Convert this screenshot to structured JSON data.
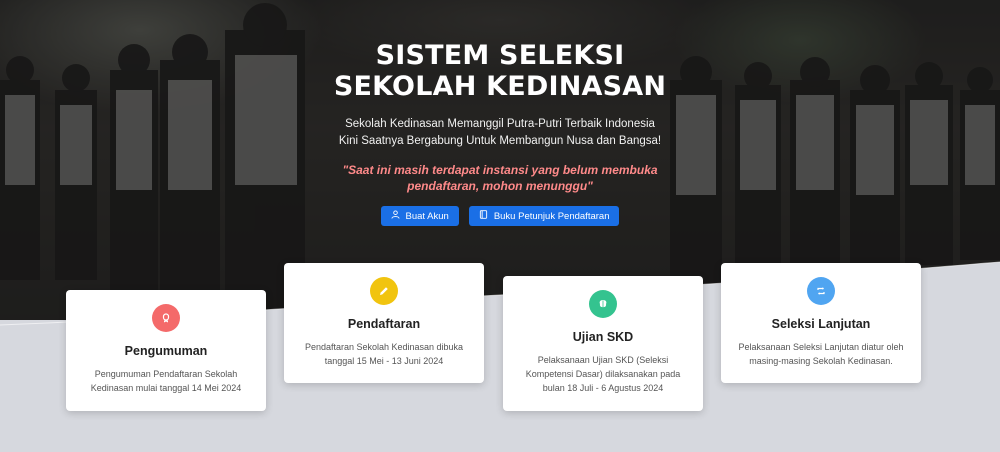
{
  "hero": {
    "title": "SISTEM SELEKSI SEKOLAH KEDINASAN",
    "subtitle_line1": "Sekolah Kedinasan Memanggil Putra-Putri Terbaik Indonesia",
    "subtitle_line2": "Kini Saatnya Bergabung Untuk Membangun Nusa dan Bangsa!",
    "notice": "\"Saat ini masih terdapat instansi yang belum membuka pendaftaran, mohon menunggu\"",
    "buttons": [
      {
        "label": "Buat Akun",
        "icon": "user-icon"
      },
      {
        "label": "Buku Petunjuk Pendaftaran",
        "icon": "book-icon"
      }
    ]
  },
  "cards": [
    {
      "title": "Pengumuman",
      "text": "Pengumuman Pendaftaran Sekolah Kedinasan mulai tanggal 14 Mei 2024",
      "icon": "megaphone-icon",
      "color": "#f46a6a"
    },
    {
      "title": "Pendaftaran",
      "text": "Pendaftaran Sekolah Kedinasan dibuka tanggal 15 Mei - 13 Juni 2024",
      "icon": "pencil-icon",
      "color": "#f1c40f"
    },
    {
      "title": "Ujian SKD",
      "text": "Pelaksanaan Ujian SKD (Seleksi Kompetensi Dasar) dilaksanakan pada bulan 18 Juli - 6 Agustus 2024",
      "icon": "brain-icon",
      "color": "#34c38f"
    },
    {
      "title": "Seleksi Lanjutan",
      "text": "Pelaksanaan Seleksi Lanjutan diatur oleh masing-masing Sekolah Kedinasan.",
      "icon": "repeat-icon",
      "color": "#50a5f1"
    }
  ]
}
